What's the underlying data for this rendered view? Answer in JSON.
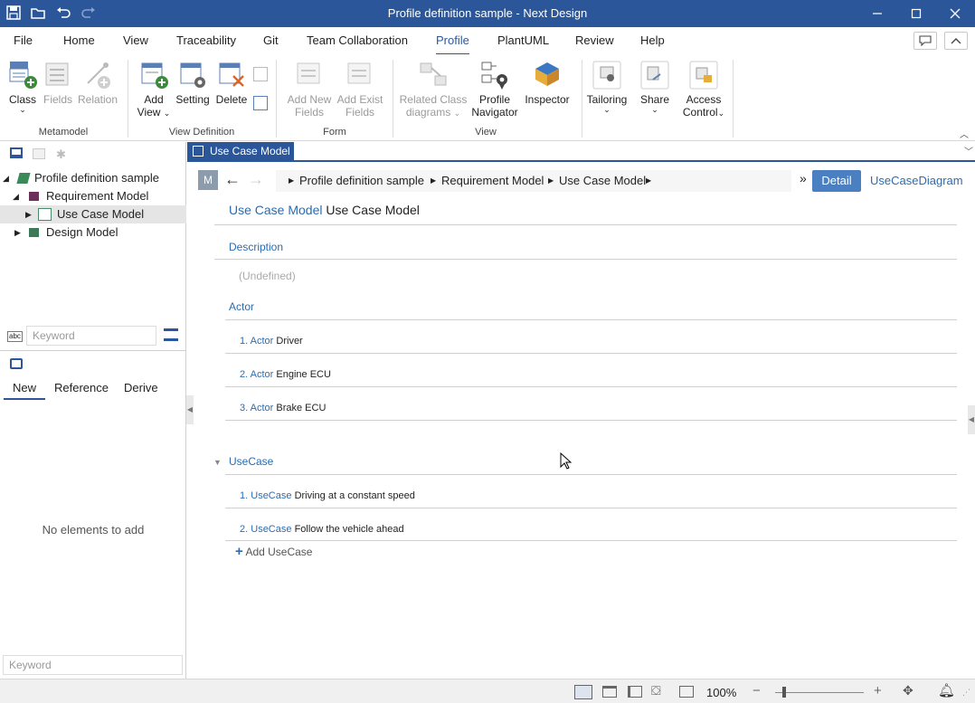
{
  "window": {
    "title": "Profile definition sample - Next Design"
  },
  "menu": {
    "items": [
      "File",
      "Home",
      "View",
      "Traceability",
      "Git",
      "Team Collaboration",
      "Profile",
      "PlantUML",
      "Review",
      "Help"
    ],
    "active": "Profile"
  },
  "ribbon": {
    "buttons": {
      "class": "Class",
      "fields": "Fields",
      "relation": "Relation",
      "add_view_1": "Add",
      "add_view_2": "View",
      "setting": "Setting",
      "delete": "Delete",
      "add_new_fields_1": "Add New",
      "add_new_fields_2": "Fields",
      "add_exist_fields_1": "Add Exist",
      "add_exist_fields_2": "Fields",
      "related_class_1": "Related Class",
      "related_class_2": "diagrams",
      "profile_nav_1": "Profile",
      "profile_nav_2": "Navigator",
      "inspector": "Inspector",
      "tailoring": "Tailoring",
      "share": "Share",
      "access_control_1": "Access",
      "access_control_2": "Control"
    },
    "groups": {
      "metamodel": "Metamodel",
      "view_definition": "View Definition",
      "form": "Form",
      "view": "View"
    }
  },
  "left_pane": {
    "tree": [
      {
        "label": "Profile definition sample"
      },
      {
        "label": "Requirement Model"
      },
      {
        "label": "Use Case Model"
      },
      {
        "label": "Design Model"
      }
    ],
    "keyword_placeholder": "Keyword",
    "tabs": [
      "New",
      "Reference",
      "Derive"
    ],
    "empty_message": "No elements to add",
    "bottom_keyword_placeholder": "Keyword"
  },
  "editor": {
    "doc_tab": "Use Case Model",
    "breadcrumb": [
      "Profile definition sample",
      "Requirement Model",
      "Use Case Model"
    ],
    "m_badge": "M",
    "detail_button": "Detail",
    "diagram_link": "UseCaseDiagram",
    "header": {
      "kind": "Use Case Model",
      "name": "Use Case Model"
    },
    "description_label": "Description",
    "description_value": "(Undefined)",
    "actor_label": "Actor",
    "actors": [
      {
        "index": "1.",
        "kind": "Actor",
        "name": "Driver"
      },
      {
        "index": "2.",
        "kind": "Actor",
        "name": "Engine ECU"
      },
      {
        "index": "3.",
        "kind": "Actor",
        "name": "Brake ECU"
      }
    ],
    "usecase_label": "UseCase",
    "usecases": [
      {
        "index": "1.",
        "kind": "UseCase",
        "name": "Driving at a constant speed"
      },
      {
        "index": "2.",
        "kind": "UseCase",
        "name": "Follow the vehicle ahead"
      }
    ],
    "add_usecase": "Add UseCase"
  },
  "statusbar": {
    "zoom": "100%"
  },
  "colors": {
    "titlebar": "#2b579a",
    "link_blue": "#2b6cb0"
  }
}
